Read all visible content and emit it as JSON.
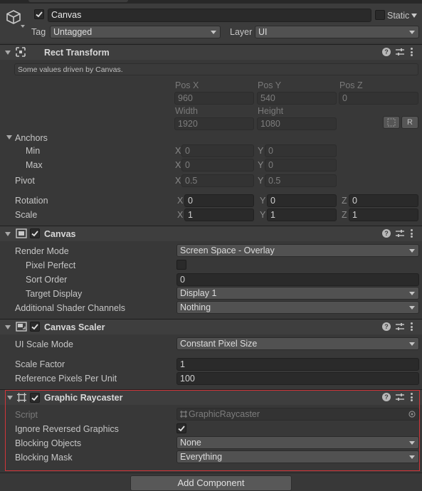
{
  "gameobject": {
    "name": "Canvas",
    "active": true,
    "static_label": "Static",
    "tag_label": "Tag",
    "tag_value": "Untagged",
    "layer_label": "Layer",
    "layer_value": "UI"
  },
  "rect_transform": {
    "title": "Rect Transform",
    "note": "Some values driven by Canvas.",
    "pos_x_label": "Pos X",
    "pos_x": "960",
    "pos_y_label": "Pos Y",
    "pos_y": "540",
    "pos_z_label": "Pos Z",
    "pos_z": "0",
    "width_label": "Width",
    "width": "1920",
    "height_label": "Height",
    "height": "1080",
    "r_button": "R",
    "anchors_label": "Anchors",
    "min_label": "Min",
    "min_x": "0",
    "min_y": "0",
    "max_label": "Max",
    "max_x": "0",
    "max_y": "0",
    "pivot_label": "Pivot",
    "pivot_x": "0.5",
    "pivot_y": "0.5",
    "rotation_label": "Rotation",
    "rot_x": "0",
    "rot_y": "0",
    "rot_z": "0",
    "scale_label": "Scale",
    "scale_x": "1",
    "scale_y": "1",
    "scale_z": "1",
    "axis_x": "X",
    "axis_y": "Y",
    "axis_z": "Z"
  },
  "canvas": {
    "title": "Canvas",
    "enabled": true,
    "render_mode_label": "Render Mode",
    "render_mode": "Screen Space - Overlay",
    "pixel_perfect_label": "Pixel Perfect",
    "pixel_perfect": false,
    "sort_order_label": "Sort Order",
    "sort_order": "0",
    "target_display_label": "Target Display",
    "target_display": "Display 1",
    "shader_channels_label": "Additional Shader Channels",
    "shader_channels": "Nothing"
  },
  "canvas_scaler": {
    "title": "Canvas Scaler",
    "enabled": true,
    "ui_scale_mode_label": "UI Scale Mode",
    "ui_scale_mode": "Constant Pixel Size",
    "scale_factor_label": "Scale Factor",
    "scale_factor": "1",
    "ref_ppu_label": "Reference Pixels Per Unit",
    "ref_ppu": "100"
  },
  "graphic_raycaster": {
    "title": "Graphic Raycaster",
    "enabled": true,
    "script_label": "Script",
    "script_value": "GraphicRaycaster",
    "ignore_reversed_label": "Ignore Reversed Graphics",
    "ignore_reversed": true,
    "blocking_objects_label": "Blocking Objects",
    "blocking_objects": "None",
    "blocking_mask_label": "Blocking Mask",
    "blocking_mask": "Everything",
    "highlight_color": "#d1353a"
  },
  "add_component_label": "Add Component",
  "icons": {
    "help": "?",
    "cube": "cube-icon",
    "rect": "rect-transform-icon",
    "canvas": "canvas-icon",
    "scaler": "canvas-scaler-icon",
    "raycaster": "graphic-raycaster-icon"
  }
}
